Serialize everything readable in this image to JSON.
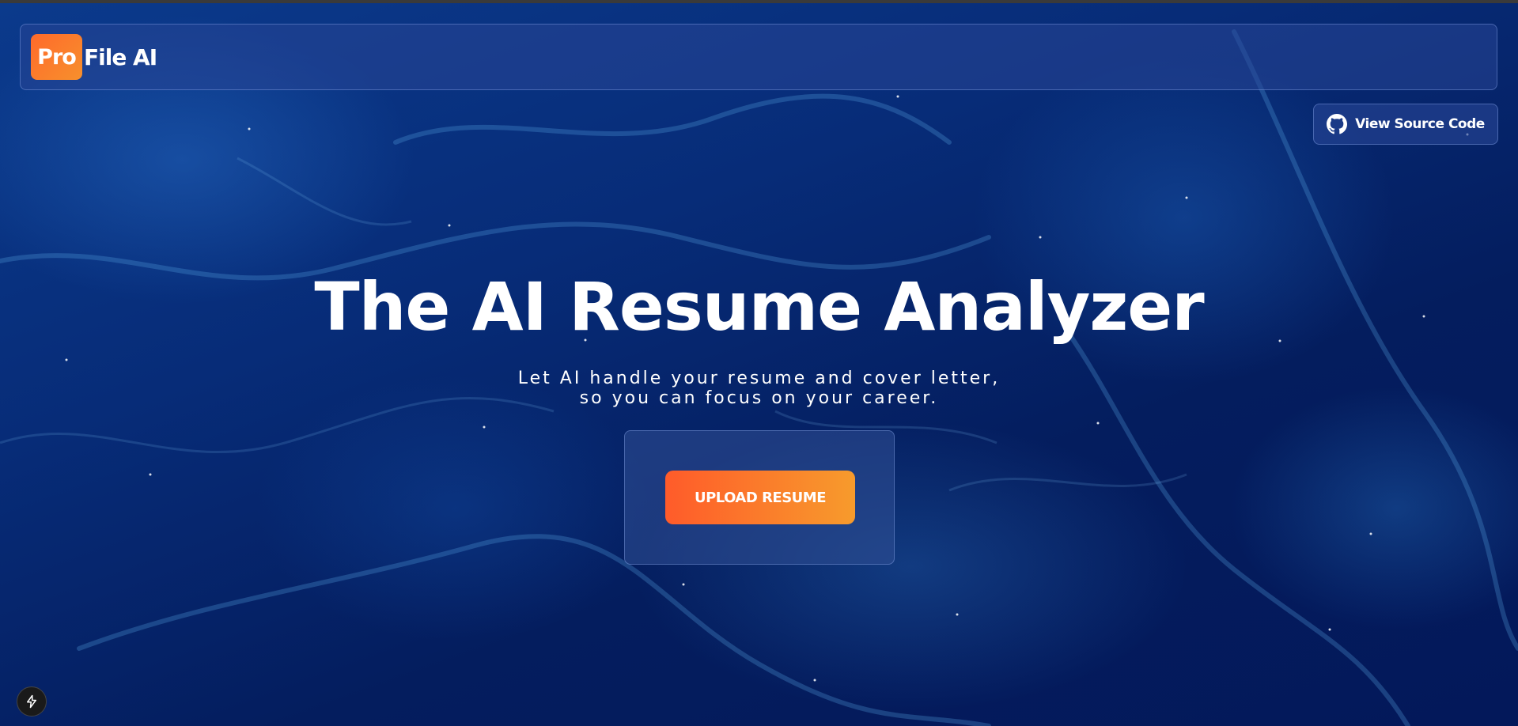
{
  "brand": {
    "badge": "Pro",
    "name": "File AI"
  },
  "header": {
    "source_label": "View Source Code"
  },
  "hero": {
    "title": "The AI Resume Analyzer",
    "subtitle_line1": "Let AI handle your resume and cover letter,",
    "subtitle_line2": "so you can focus on your career."
  },
  "upload": {
    "button_label": "UPLOAD RESUME"
  },
  "icons": {
    "github": "github-icon",
    "bolt": "lightning-bolt-icon"
  },
  "colors": {
    "accent_start": "#ff5b2a",
    "accent_end": "#f79b2c",
    "background": "#072c78"
  }
}
